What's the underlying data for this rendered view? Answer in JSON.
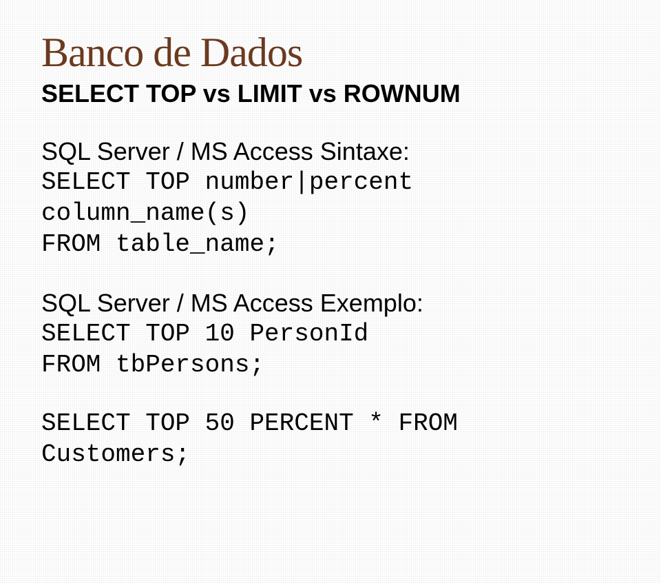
{
  "title": "Banco de Dados",
  "subtitle": "SELECT TOP vs LIMIT vs ROWNUM",
  "syntax": {
    "label": "SQL Server / MS Access Sintaxe:",
    "code": "SELECT TOP number|percent\ncolumn_name(s)\nFROM table_name;"
  },
  "example": {
    "label": "SQL Server / MS Access Exemplo:",
    "code": "SELECT TOP 10 PersonId\nFROM tbPersons;"
  },
  "example2": {
    "code": "SELECT TOP 50 PERCENT * FROM\nCustomers;"
  }
}
